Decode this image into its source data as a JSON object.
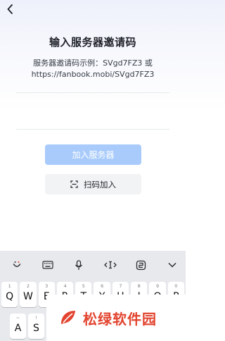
{
  "header": {
    "back_icon": "chevron-left-icon"
  },
  "title": "输入服务器邀请码",
  "hint": {
    "line1": "服务器邀请码示例：SVgd7FZ3 或",
    "line2": "https://fanbook.mobi/SVgd7FZ3"
  },
  "invite_input": {
    "value": "",
    "placeholder": ""
  },
  "join_button": {
    "label": "加入服务器",
    "color": "#a9cbfb"
  },
  "scan_button": {
    "label": "扫码加入",
    "icon": "scan-icon"
  },
  "keyboard": {
    "toolbar": [
      "emoji-icon",
      "keyboard-icon",
      "microphone-icon",
      "cursor-move-icon",
      "clipboard-icon",
      "collapse-keyboard-icon"
    ],
    "row1": [
      {
        "key": "Q",
        "sub": "1"
      },
      {
        "key": "W",
        "sub": "2"
      },
      {
        "key": "E",
        "sub": "3"
      },
      {
        "key": "R",
        "sub": "4"
      },
      {
        "key": "T",
        "sub": "5"
      },
      {
        "key": "Y",
        "sub": "6"
      },
      {
        "key": "U",
        "sub": "7"
      },
      {
        "key": "I",
        "sub": "8"
      },
      {
        "key": "O",
        "sub": "9"
      },
      {
        "key": "P",
        "sub": "0"
      }
    ],
    "row2": [
      {
        "key": "A",
        "sub": "~"
      },
      {
        "key": "S",
        "sub": "!"
      }
    ]
  },
  "watermark": {
    "text": "松绿软件园",
    "color": "#e2442f"
  }
}
